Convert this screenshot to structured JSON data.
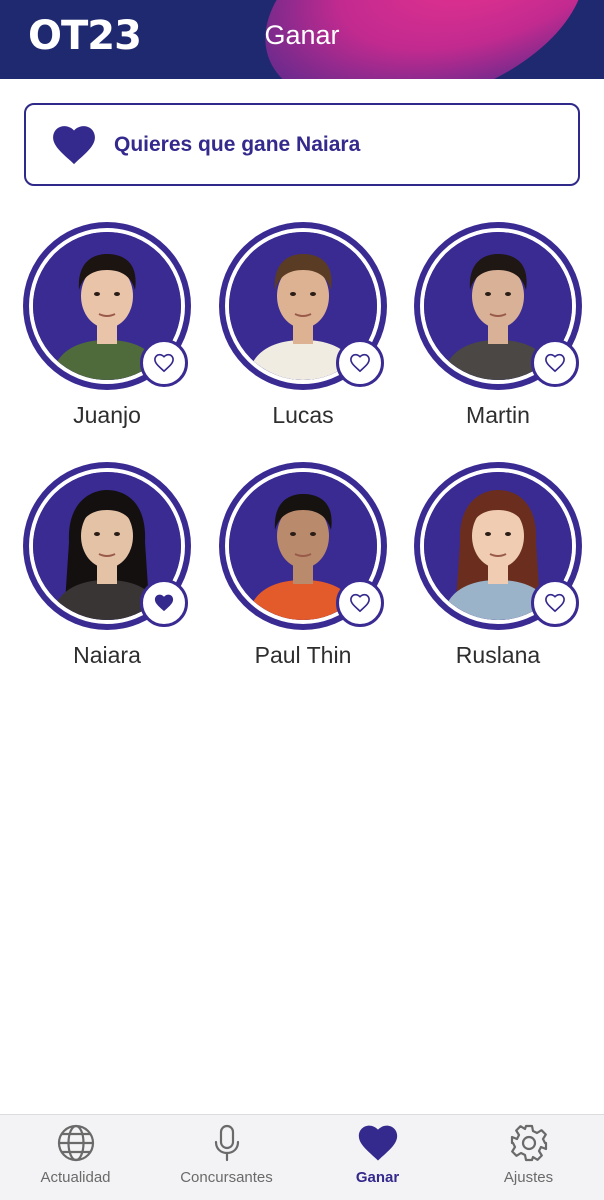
{
  "header": {
    "logo_text": "OT23",
    "title": "Ganar"
  },
  "favorite_banner": {
    "text": "Quieres que gane Naiara",
    "icon": "heart-filled-icon"
  },
  "contestants": [
    {
      "name": "Juanjo",
      "liked": false
    },
    {
      "name": "Lucas",
      "liked": false
    },
    {
      "name": "Martin",
      "liked": false
    },
    {
      "name": "Naiara",
      "liked": true
    },
    {
      "name": "Paul Thin",
      "liked": false
    },
    {
      "name": "Ruslana",
      "liked": false
    }
  ],
  "bottom_nav": {
    "items": [
      {
        "label": "Actualidad",
        "icon": "globe-icon",
        "active": false
      },
      {
        "label": "Concursantes",
        "icon": "microphone-icon",
        "active": false
      },
      {
        "label": "Ganar",
        "icon": "heart-icon",
        "active": true
      },
      {
        "label": "Ajustes",
        "icon": "gear-icon",
        "active": false
      }
    ]
  },
  "colors": {
    "brand": "#34298c",
    "header_bg": "#1f2970",
    "accent_pink": "#e8338f"
  }
}
